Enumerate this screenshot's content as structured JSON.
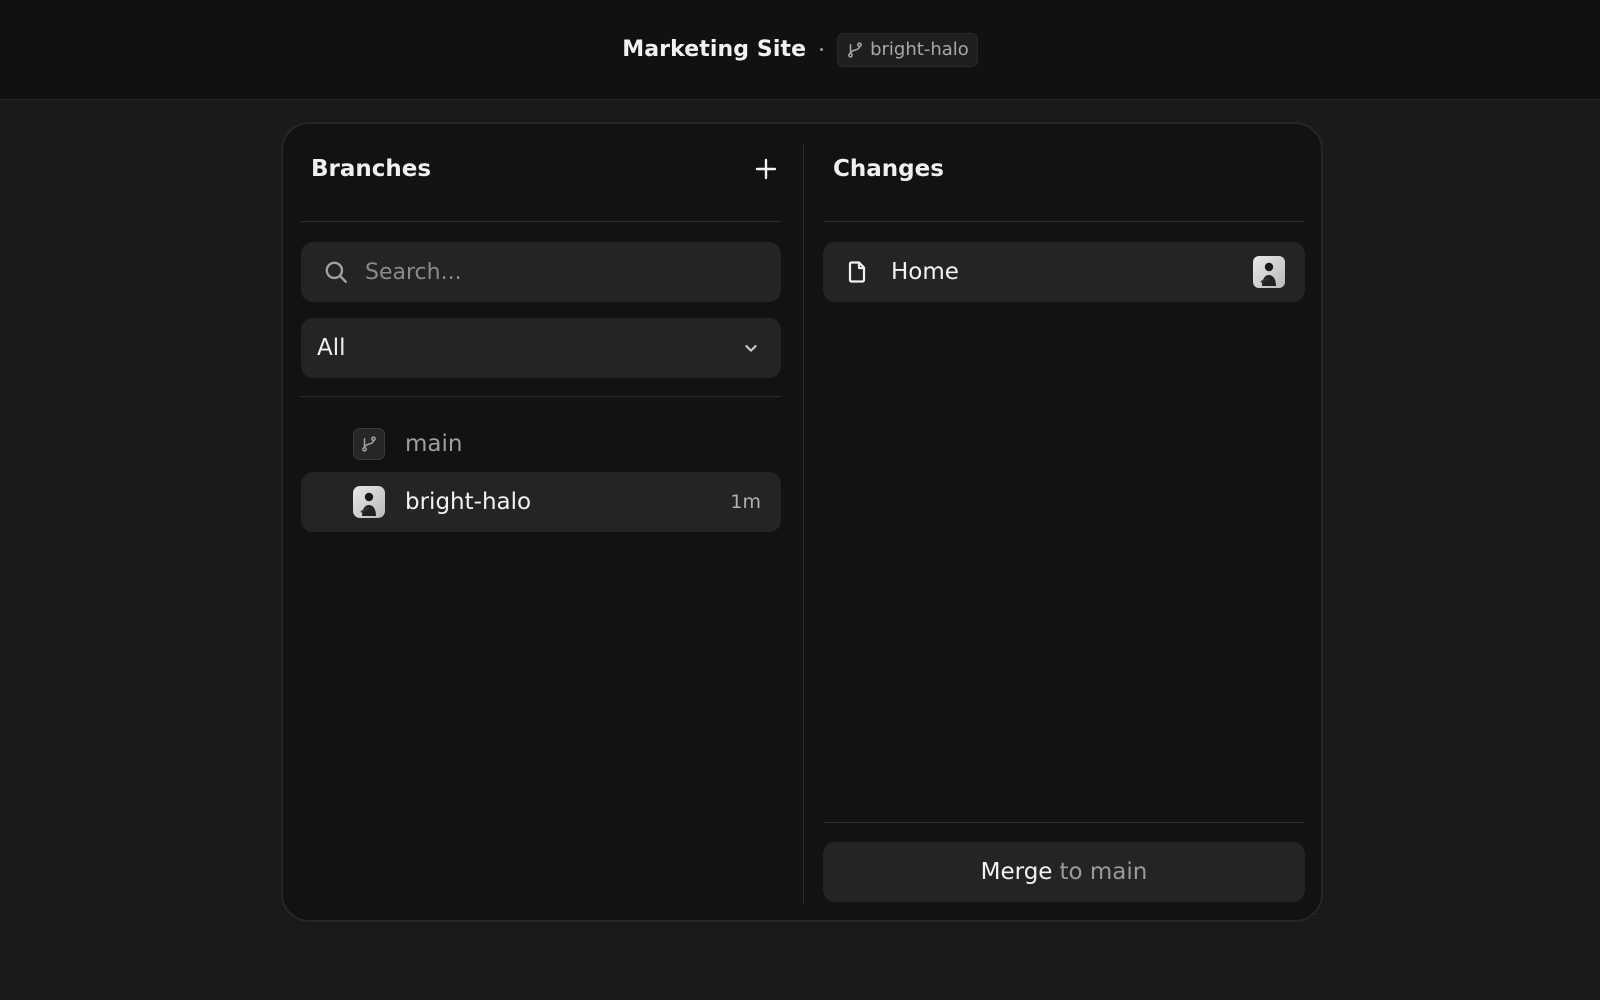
{
  "header": {
    "project_title": "Marketing Site",
    "current_branch": "bright-halo"
  },
  "branches_panel": {
    "title": "Branches",
    "search": {
      "placeholder": "Search...",
      "value": ""
    },
    "filter": {
      "selected": "All"
    },
    "items": [
      {
        "name": "main",
        "icon": "branch-icon",
        "time": "",
        "selected": false
      },
      {
        "name": "bright-halo",
        "icon": "avatar",
        "time": "1m",
        "selected": true
      }
    ]
  },
  "changes_panel": {
    "title": "Changes",
    "items": [
      {
        "name": "Home",
        "icon": "file-icon"
      }
    ]
  },
  "merge": {
    "verb": "Merge",
    "target": "to main"
  },
  "colors": {
    "background": "#191919",
    "panel": "#121212",
    "surface": "#242424",
    "text": "#f2f2f2",
    "muted": "#9a9a9a"
  }
}
